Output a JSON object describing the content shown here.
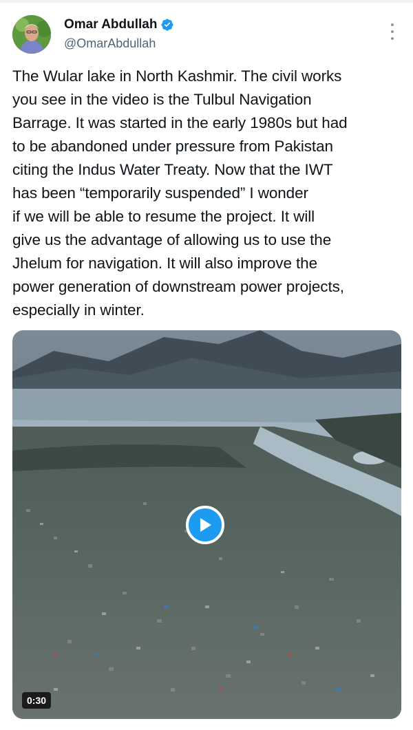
{
  "author": {
    "display_name": "Omar Abdullah",
    "handle": "@OmarAbdullah",
    "verified_icon": "verified-badge-icon"
  },
  "tweet": {
    "text": "The Wular lake in North Kashmir. The civil works\nyou see in the video is the Tulbul Navigation\nBarrage.  It was started in the early 1980s but had\nto be abandoned under pressure from Pakistan\nciting the Indus Water Treaty. Now that the IWT\nhas been “temporarily suspended” I wonder\nif we will be able to resume the project. It will\ngive us the advantage of allowing us to use the\nJhelum for navigation. It will also improve the\npower generation of downstream power projects,\nespecially in winter."
  },
  "media": {
    "duration": "0:30",
    "play_icon": "play-icon"
  },
  "colors": {
    "accent": "#1d9bf0",
    "text": "#0f1419",
    "secondary": "#536471"
  }
}
